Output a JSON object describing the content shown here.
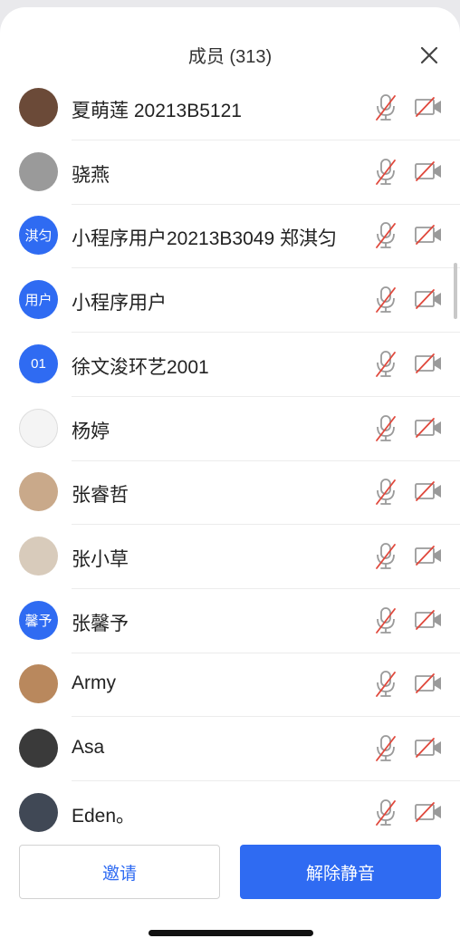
{
  "header": {
    "title": "成员 (313)"
  },
  "members": [
    {
      "name": "夏萌莲 20213B5121",
      "avatar_type": "photo",
      "avatar_color": "#6b4a38",
      "avatar_text": ""
    },
    {
      "name": "骁燕",
      "avatar_type": "photo",
      "avatar_color": "#9a9a9a",
      "avatar_text": ""
    },
    {
      "name": "小程序用户20213B3049 郑淇匀",
      "avatar_type": "text",
      "avatar_color": "#2f6bf2",
      "avatar_text": "淇匀"
    },
    {
      "name": "小程序用户",
      "avatar_type": "text",
      "avatar_color": "#2f6bf2",
      "avatar_text": "用户"
    },
    {
      "name": "徐文浚环艺2001",
      "avatar_type": "text",
      "avatar_color": "#2f6bf2",
      "avatar_text": "01"
    },
    {
      "name": "杨婷",
      "avatar_type": "photo",
      "avatar_color": "#f4f4f4",
      "avatar_text": ""
    },
    {
      "name": "张睿哲",
      "avatar_type": "photo",
      "avatar_color": "#c9a98a",
      "avatar_text": ""
    },
    {
      "name": "张小草",
      "avatar_type": "photo",
      "avatar_color": "#d8cbbb",
      "avatar_text": ""
    },
    {
      "name": "张馨予",
      "avatar_type": "text",
      "avatar_color": "#2f6bf2",
      "avatar_text": "馨予"
    },
    {
      "name": "Army",
      "avatar_type": "photo",
      "avatar_color": "#b9885d",
      "avatar_text": ""
    },
    {
      "name": "Asa",
      "avatar_type": "photo",
      "avatar_color": "#3a3a3a",
      "avatar_text": ""
    },
    {
      "name": "Eden。",
      "avatar_type": "photo",
      "avatar_color": "#404855",
      "avatar_text": ""
    }
  ],
  "actions": {
    "invite_label": "邀请",
    "unmute_label": "解除静音"
  },
  "colors": {
    "accent": "#2f6bf2",
    "muted_red": "#e0483c",
    "icon_gray": "#9a9a9a"
  },
  "icons": {
    "close": "close-icon",
    "mic": "mic-muted-icon",
    "camera": "camera-off-icon"
  }
}
